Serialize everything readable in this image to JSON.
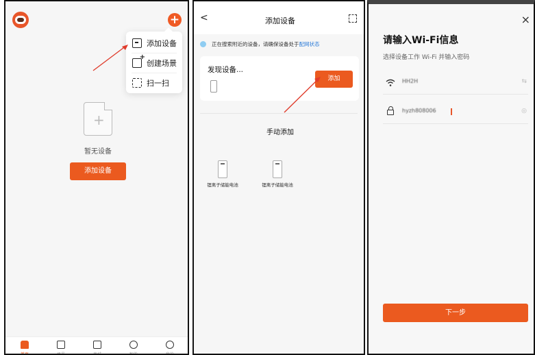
{
  "home": {
    "menu": [
      {
        "label": "添加设备",
        "icon": "add-device-icon"
      },
      {
        "label": "创建场景",
        "icon": "create-scene-icon"
      },
      {
        "label": "扫一扫",
        "icon": "scan-icon"
      }
    ],
    "empty_text": "暂无设备",
    "add_button": "添加设备",
    "tabs": [
      {
        "label": "首页",
        "icon": "home-icon"
      },
      {
        "label": "场景",
        "icon": "scene-icon"
      },
      {
        "label": "商城",
        "icon": "shop-icon"
      },
      {
        "label": "智能",
        "icon": "smart-icon"
      },
      {
        "label": "我的",
        "icon": "profile-icon"
      }
    ]
  },
  "add_device": {
    "title": "添加设备",
    "back": "<",
    "hint": "正在搜索附近的设备，请确保设备处于",
    "hint_link": "配网状态",
    "found_title": "发现设备...",
    "add_button": "添加",
    "manual_title": "手动添加",
    "manual_items": [
      {
        "label": "锂离子储能电池"
      },
      {
        "label": "锂离子储能电池"
      }
    ]
  },
  "wifi": {
    "close": "×",
    "title": "请输入Wi-Fi信息",
    "subtitle": "选择设备工作 Wi-Fi 并输入密码",
    "ssid": "HH2H",
    "password": "hyzh808006",
    "swap_icon": "⇆",
    "eye_icon": "◎",
    "next_button": "下一步"
  },
  "colors": {
    "accent": "#eb5a1f",
    "link": "#2b7bd8"
  }
}
